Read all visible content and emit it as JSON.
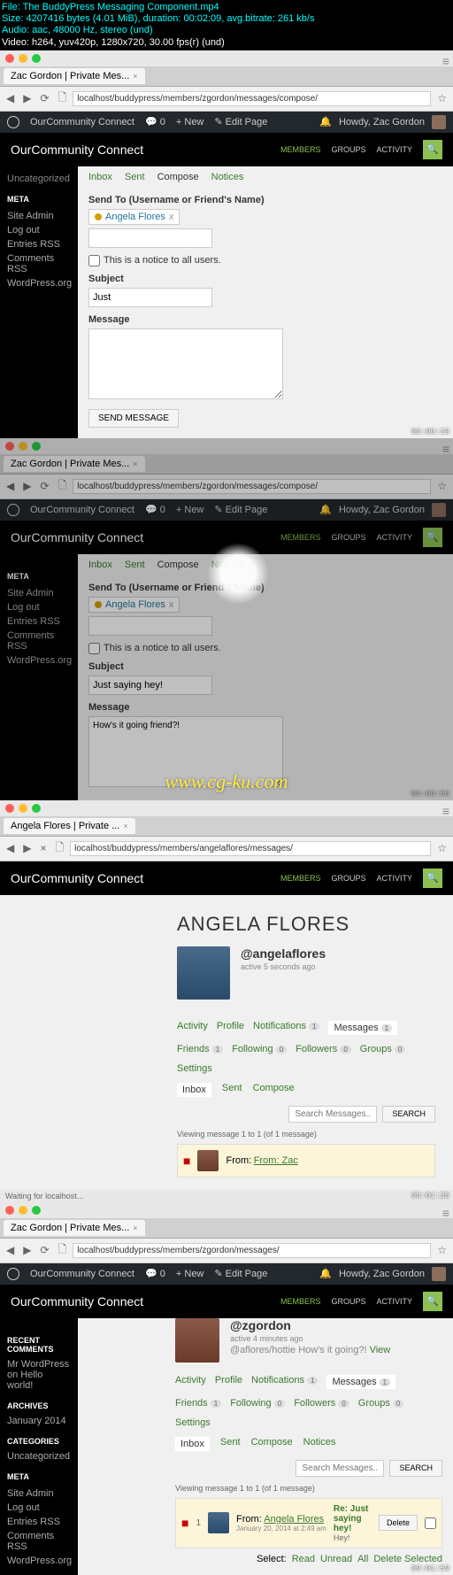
{
  "video_info": {
    "file": "File: The BuddyPress Messaging Component.mp4",
    "size": "Size: 4207416 bytes (4.01 MiB), duration: 00:02:09, avg.bitrate: 261 kb/s",
    "audio": "Audio: aac, 48000 Hz, stereo (und)",
    "video": "Video: h264, yuv420p, 1280x720, 30.00 fps(r) (und)"
  },
  "browser": {
    "tab1": "Zac Gordon | Private Mes...",
    "tab2": "Zac Gordon | Private Mes...",
    "tab3": "Angela Flores | Private ...",
    "tab4": "Zac Gordon | Private Mes...",
    "url1": "localhost/buddypress/members/zgordon/messages/compose/",
    "url2": "localhost/buddypress/members/zgordon/messages/compose/",
    "url3": "localhost/buddypress/members/angelaflores/messages/",
    "url4": "localhost/buddypress/members/zgordon/messages/"
  },
  "wp_bar": {
    "site": "OurCommunity Connect",
    "comments": "0",
    "new": "New",
    "edit": "Edit Page",
    "howdy": "Howdy, Zac Gordon"
  },
  "site_title": "OurCommunity Connect",
  "nav": {
    "members": "MEMBERS",
    "groups": "GROUPS",
    "activity": "ACTIVITY"
  },
  "sidebar": {
    "uncategorized": "Uncategorized",
    "meta_h": "META",
    "meta": [
      "Site Admin",
      "Log out",
      "Entries RSS",
      "Comments RSS",
      "WordPress.org"
    ],
    "recent_h": "RECENT COMMENTS",
    "recent": "Mr WordPress on Hello world!",
    "archives_h": "ARCHIVES",
    "archives": "January 2014",
    "categories_h": "CATEGORIES"
  },
  "msg_tabs": {
    "inbox": "Inbox",
    "sent": "Sent",
    "compose": "Compose",
    "notices": "Notices"
  },
  "compose": {
    "send_to": "Send To (Username or Friend's Name)",
    "recipient": "Angela Flores",
    "notice": "This is a notice to all users.",
    "subject_label": "Subject",
    "subject_v1": "Just",
    "subject_v2": "Just saying hey!",
    "message_label": "Message",
    "message_v2": "How's it going friend?!",
    "send_btn": "SEND MESSAGE"
  },
  "watermark": "www.cg-ku.com",
  "timecodes": {
    "t1": "00:00:39",
    "t2": "00:00:56",
    "t3": "00:01:35",
    "t4": "00:01:59"
  },
  "profile_a": {
    "name": "ANGELA FLORES",
    "handle": "@angelaflores",
    "active": "active 5 seconds ago"
  },
  "profile_z": {
    "handle": "@zgordon",
    "active": "active 4 minutes ago",
    "status_pre": "@aflores/hottie How's it going?! ",
    "view": "View"
  },
  "pnav": {
    "activity": "Activity",
    "profile": "Profile",
    "notifications": "Notifications",
    "messages": "Messages",
    "friends": "Friends",
    "following": "Following",
    "followers": "Followers",
    "groups": "Groups",
    "settings": "Settings"
  },
  "counts": {
    "notif": "1",
    "msg": "1",
    "friends": "1",
    "following": "0",
    "followers": "0",
    "groups": "0"
  },
  "search": {
    "placeholder": "Search Messages...",
    "btn": "SEARCH"
  },
  "pagination": "Viewing message 1 to 1 (of 1 message)",
  "msg_row": {
    "from_label": "From:",
    "from": "Angela Flores",
    "date": "January 20, 2014 at 2:49 am",
    "subject": "Re: Just saying hey!",
    "excerpt": "Hey!",
    "delete": "Delete"
  },
  "bulk": {
    "select": "Select:",
    "read": "Read",
    "unread": "Unread",
    "all": "All",
    "del": "Delete Selected"
  },
  "status": "Waiting for localhost...",
  "from_header": "From: Zac"
}
